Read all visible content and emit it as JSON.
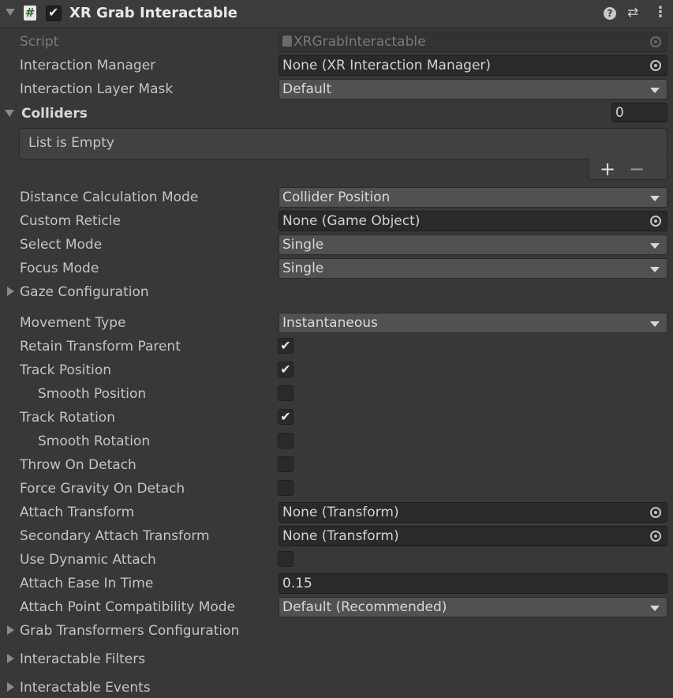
{
  "header": {
    "title": "XR Grab Interactable",
    "script_icon_glyph": "#",
    "help_glyph": "?",
    "presets_glyph": "⇄",
    "menu_glyph": "⋮"
  },
  "fields": {
    "script": {
      "label": "Script",
      "value": "XRGrabInteractable"
    },
    "interaction_manager": {
      "label": "Interaction Manager",
      "value": "None (XR Interaction Manager)"
    },
    "interaction_layer_mask": {
      "label": "Interaction Layer Mask",
      "value": "Default"
    },
    "colliders": {
      "label": "Colliders",
      "count": "0",
      "empty_text": "List is Empty",
      "add_glyph": "+",
      "remove_glyph": "−"
    },
    "distance_calc_mode": {
      "label": "Distance Calculation Mode",
      "value": "Collider Position"
    },
    "custom_reticle": {
      "label": "Custom Reticle",
      "value": "None (Game Object)"
    },
    "select_mode": {
      "label": "Select Mode",
      "value": "Single"
    },
    "focus_mode": {
      "label": "Focus Mode",
      "value": "Single"
    },
    "gaze_configuration": {
      "label": "Gaze Configuration"
    },
    "movement_type": {
      "label": "Movement Type",
      "value": "Instantaneous"
    },
    "retain_transform_parent": {
      "label": "Retain Transform Parent",
      "checked": true
    },
    "track_position": {
      "label": "Track Position",
      "checked": true
    },
    "smooth_position": {
      "label": "Smooth Position",
      "checked": false
    },
    "track_rotation": {
      "label": "Track Rotation",
      "checked": true
    },
    "smooth_rotation": {
      "label": "Smooth Rotation",
      "checked": false
    },
    "throw_on_detach": {
      "label": "Throw On Detach",
      "checked": false
    },
    "force_gravity_on_detach": {
      "label": "Force Gravity On Detach",
      "checked": false
    },
    "attach_transform": {
      "label": "Attach Transform",
      "value": "None (Transform)"
    },
    "secondary_attach_transform": {
      "label": "Secondary Attach Transform",
      "value": "None (Transform)"
    },
    "use_dynamic_attach": {
      "label": "Use Dynamic Attach",
      "checked": false
    },
    "attach_ease_in_time": {
      "label": "Attach Ease In Time",
      "value": "0.15"
    },
    "attach_point_compat_mode": {
      "label": "Attach Point Compatibility Mode",
      "value": "Default (Recommended)"
    },
    "grab_transformers_config": {
      "label": "Grab Transformers Configuration"
    },
    "interactable_filters": {
      "label": "Interactable Filters"
    },
    "interactable_events": {
      "label": "Interactable Events"
    }
  },
  "checkmark_glyph": "✔",
  "colors": {
    "background": "#383838",
    "field": "#2a2a2a",
    "dropdown": "#515151",
    "text": "#c4c4c4"
  }
}
